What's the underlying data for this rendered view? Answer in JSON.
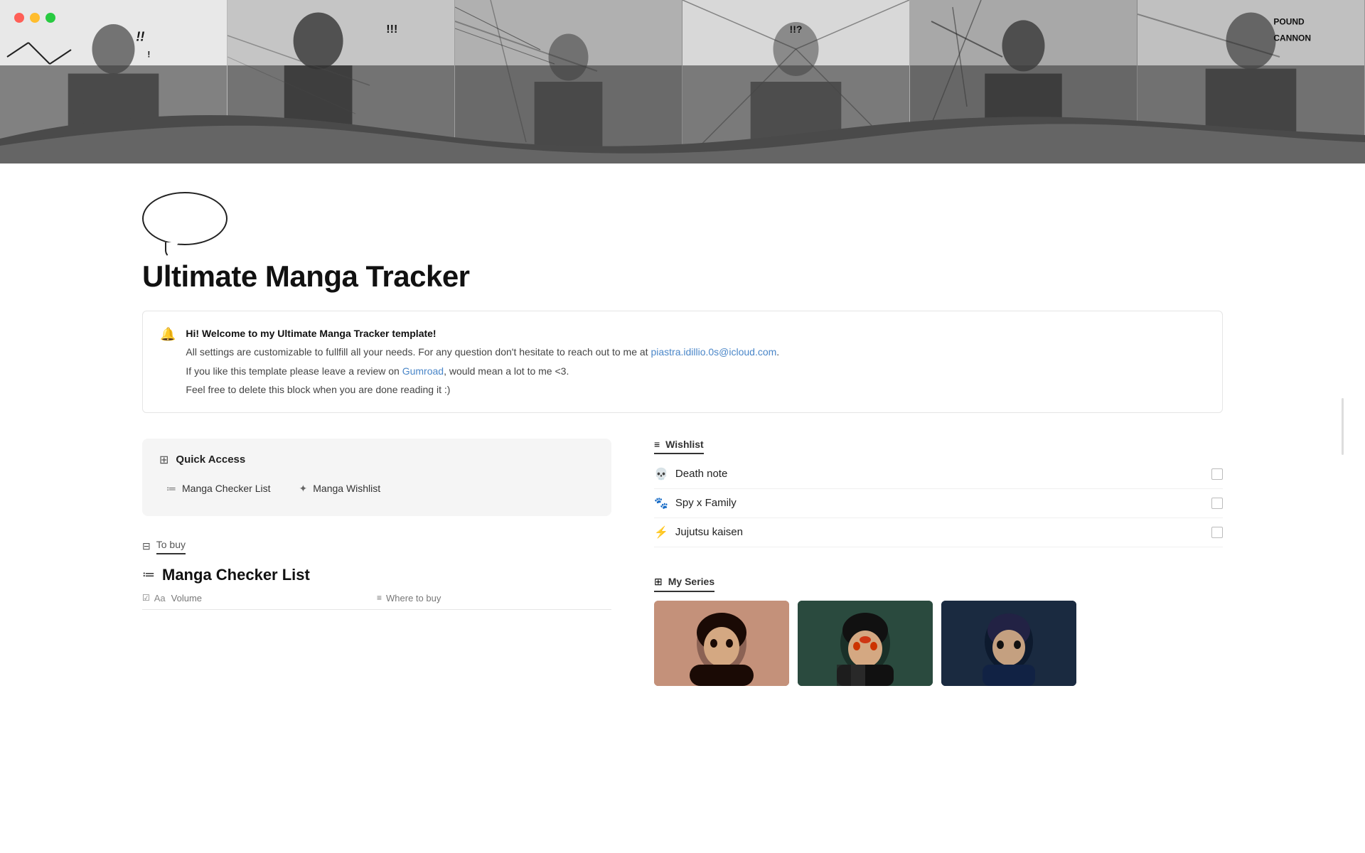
{
  "window": {
    "traffic_lights": [
      "red",
      "yellow",
      "green"
    ]
  },
  "hero": {
    "panel_text": "POUND CANNON"
  },
  "page_icon": "speech-bubble",
  "page_title": "Ultimate Manga Tracker",
  "callout": {
    "icon": "🔔",
    "welcome_bold": "Hi! Welcome to my Ultimate Manga Tracker template!",
    "line1_prefix": "All settings are customizable to fullfill all your needs. For any question don't hesitate to reach out to me at ",
    "line1_email": "piastra.idillio.0s@icloud.com",
    "line1_suffix": ".",
    "line2_prefix": "If you like this template please leave a review on ",
    "line2_link": "Gumroad",
    "line2_suffix": ", would mean a lot to me <3.",
    "line3": "Feel free to delete this block when you are done reading it :)"
  },
  "quick_access": {
    "title": "Quick Access",
    "icon": "⊞",
    "items": [
      {
        "icon": "≔",
        "label": "Manga Checker List"
      },
      {
        "icon": "✦",
        "label": "Manga Wishlist"
      }
    ]
  },
  "to_buy_section": {
    "icon": "⊟",
    "label": "To buy"
  },
  "manga_checker": {
    "icon": "≔",
    "title": "Manga Checker List",
    "columns": [
      {
        "icon": "☑",
        "prefix": "Aa",
        "label": "Volume"
      },
      {
        "icon": "≡",
        "label": "Where to buy"
      }
    ]
  },
  "wishlist": {
    "icon": "≡",
    "title": "Wishlist",
    "items": [
      {
        "icon": "💀",
        "name": "Death note",
        "checked": false
      },
      {
        "icon": "🐾",
        "name": "Spy x Family",
        "checked": false
      },
      {
        "icon": "⚡",
        "name": "Jujutsu kaisen",
        "checked": false
      }
    ]
  },
  "my_series": {
    "icon": "⊞",
    "title": "My Series",
    "cards": [
      {
        "id": "card-1",
        "color_class": "series-card-1",
        "alt": "Character 1"
      },
      {
        "id": "card-2",
        "color_class": "series-card-2",
        "alt": "Character 2"
      },
      {
        "id": "card-3",
        "color_class": "series-card-3",
        "alt": "Character 3"
      }
    ]
  }
}
